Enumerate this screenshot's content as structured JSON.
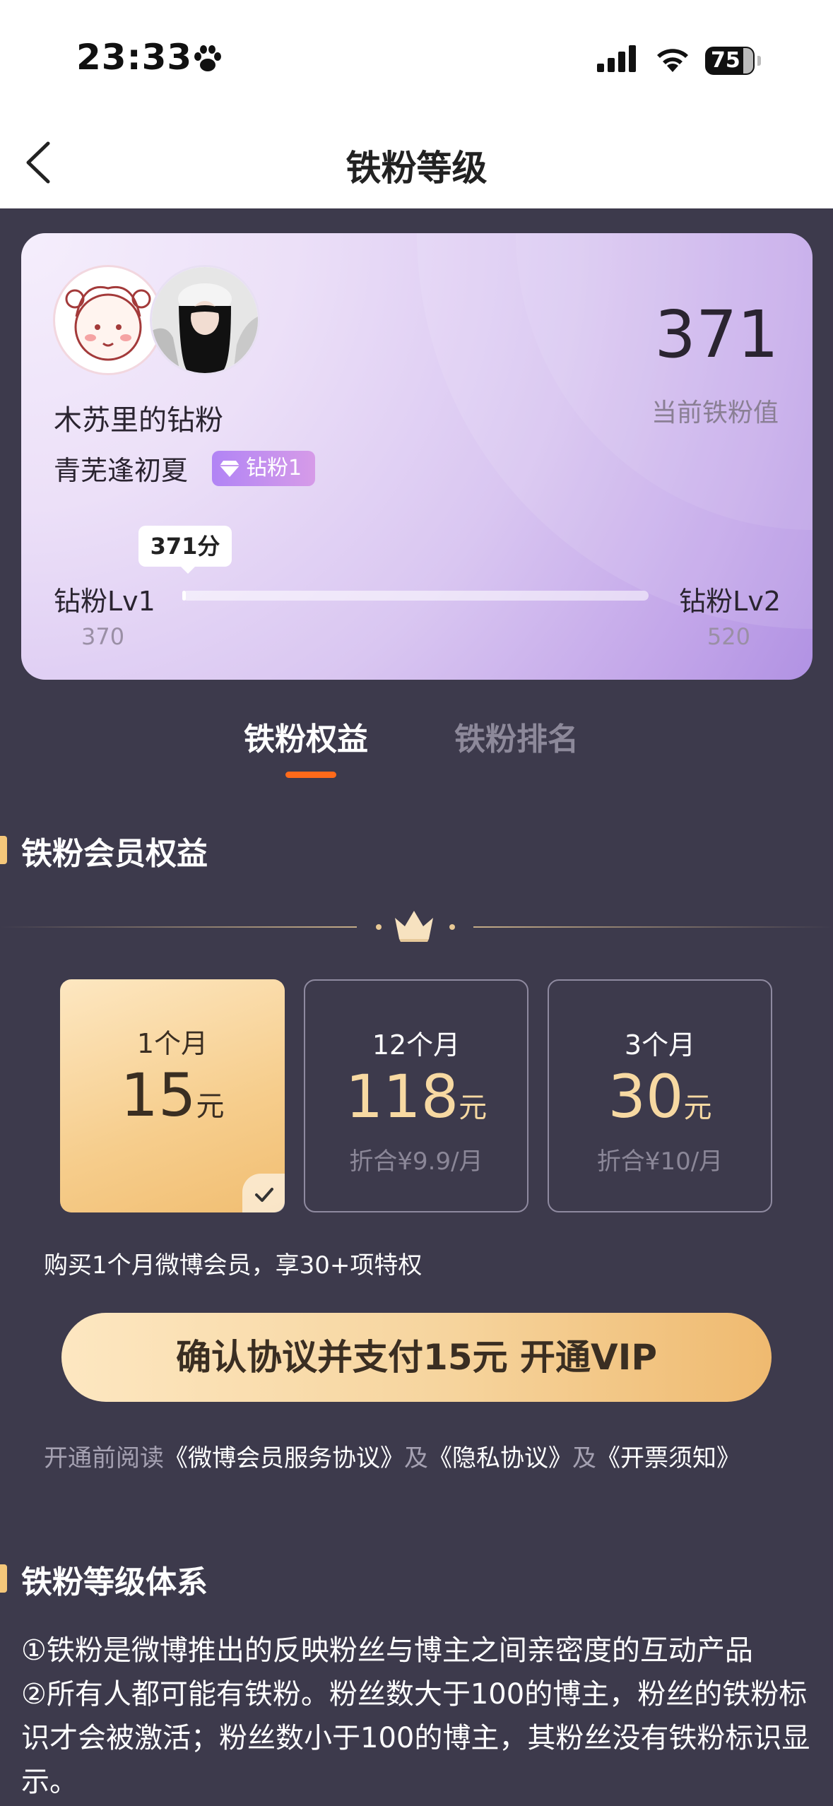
{
  "status_bar": {
    "time": "23:33",
    "battery": "75"
  },
  "header": {
    "title": "铁粉等级"
  },
  "card": {
    "fan_name": "木苏里的钻粉",
    "user_name": "青芜逢初夏",
    "badge": "钻粉1",
    "score": "371",
    "score_label": "当前铁粉值",
    "tooltip": "371分",
    "level_left": "钻粉Lv1",
    "level_right": "钻粉Lv2",
    "level_left_value": "370",
    "level_right_value": "520",
    "progress_fraction": 0.0067
  },
  "tabs": [
    {
      "label": "铁粉权益",
      "active": true
    },
    {
      "label": "铁粉排名",
      "active": false
    }
  ],
  "membership": {
    "section_title": "铁粉会员权益",
    "plans": [
      {
        "months": "1个月",
        "price": "15",
        "unit": "元",
        "per": "",
        "selected": true
      },
      {
        "months": "12个月",
        "price": "118",
        "unit": "元",
        "per": "折合¥9.9/月",
        "selected": false
      },
      {
        "months": "3个月",
        "price": "30",
        "unit": "元",
        "per": "折合¥10/月",
        "selected": false
      }
    ],
    "description": "购买1个月微博会员，享30+项特权",
    "pay_button": "确认协议并支付15元 开通VIP",
    "agreement": {
      "prefix": "开通前阅读",
      "link1": "《微博会员服务协议》",
      "and1": "及",
      "link2": "《隐私协议》",
      "and2": "及",
      "link3": "《开票须知》"
    }
  },
  "level_system": {
    "section_title": "铁粉等级体系",
    "rules": [
      "①铁粉是微博推出的反映粉丝与博主之间亲密度的互动产品",
      "②所有人都可能有铁粉。粉丝数大于100的博主，粉丝的铁粉标识才会被激活；粉丝数小于100的博主，其粉丝没有铁粉标识显示。"
    ]
  },
  "colors": {
    "accent": "#ff6a1a",
    "gold": "#f6cd8c",
    "background": "#3d3a4c"
  }
}
